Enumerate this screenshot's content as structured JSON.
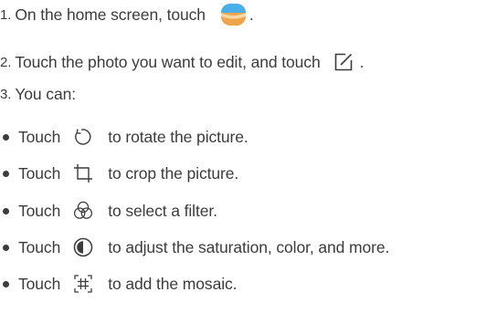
{
  "steps": [
    {
      "number": "1.",
      "text_before": "On the home screen, touch",
      "icon": "gallery-app-icon",
      "text_after": "."
    },
    {
      "number": "2.",
      "text_before": "Touch the photo you want to edit, and touch",
      "icon": "edit-icon",
      "text_after": "."
    },
    {
      "number": "3.",
      "text": "You can:"
    }
  ],
  "options": [
    {
      "touch": "Touch",
      "icon": "rotate-icon",
      "text": "to rotate the picture."
    },
    {
      "touch": "Touch",
      "icon": "crop-icon",
      "text": "to crop the picture."
    },
    {
      "touch": "Touch",
      "icon": "filter-icon",
      "text": "to select a filter."
    },
    {
      "touch": "Touch",
      "icon": "adjust-icon",
      "text": "to adjust the saturation, color, and more."
    },
    {
      "touch": "Touch",
      "icon": "mosaic-icon",
      "text": "to add the mosaic."
    }
  ],
  "colors": {
    "text": "#3c3c3c",
    "gallery_icon_top": "#4aaee8",
    "gallery_icon_bottom": "#f0a44a"
  }
}
